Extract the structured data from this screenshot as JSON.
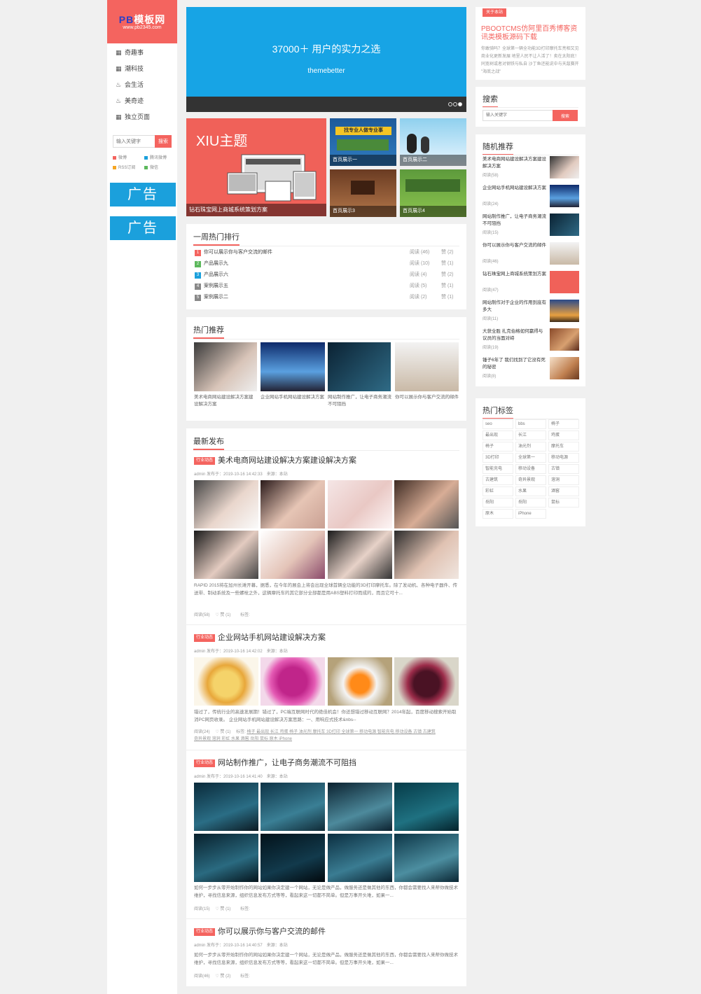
{
  "sidebar": {
    "logo_brand": "PB",
    "logo_name": "模板网",
    "logo_url": "www.pb2345.com",
    "nav": [
      {
        "icon": "grid-icon",
        "label": "奇趣事"
      },
      {
        "icon": "grid-icon",
        "label": "潮科技"
      },
      {
        "icon": "fire-icon",
        "label": "会生活"
      },
      {
        "icon": "fire-icon",
        "label": "美奇迹"
      },
      {
        "icon": "grid-icon",
        "label": "独立页面"
      }
    ],
    "search_placeholder": "输入关键字",
    "search_button": "搜索",
    "links": [
      "微博",
      "腾讯微博",
      "RSS订阅",
      "微信"
    ],
    "ads": [
      "广告",
      "广告"
    ]
  },
  "banner": {
    "headline": "37000＋ 用户的实力之选",
    "sub": "themebetter"
  },
  "feature": {
    "main_title": "XIU主题",
    "main_caption": "钻石珠宝网上商城系统策划方案",
    "tiles": [
      "首页展示一",
      "首页展示二",
      "首页展示3",
      "首页展示4"
    ]
  },
  "hot_rank": {
    "title": "一周热门排行",
    "items": [
      {
        "num": "1",
        "title": "你可以展示你与客户交流的邮件",
        "read": "阅读 (46)",
        "like": "赞 (2)"
      },
      {
        "num": "2",
        "title": "产品展示九",
        "read": "阅读 (10)",
        "like": "赞 (1)"
      },
      {
        "num": "3",
        "title": "产品展示六",
        "read": "阅读 (4)",
        "like": "赞 (2)"
      },
      {
        "num": "4",
        "title": "案例展示五",
        "read": "阅读 (5)",
        "like": "赞 (1)"
      },
      {
        "num": "5",
        "title": "案例展示二",
        "read": "阅读 (2)",
        "like": "赞 (1)"
      }
    ]
  },
  "hot_recommend": {
    "title": "热门推荐",
    "items": [
      "美术电商网站建设解决方案建设解决方案",
      "企业网站手机网站建设解决方案",
      "网站制作推广，让电子商务潮流不可阻挡",
      "你可以展示你与客户交流的邮件"
    ]
  },
  "latest": {
    "title": "最新发布",
    "posts": [
      {
        "tag": "行业动态",
        "title": "美术电商网站建设解决方案建设解决方案",
        "meta": "admin 发布于：2019-10-16 14:42:33　来源：本站",
        "excerpt": "RAPID 2015将在加州长滩开幕，据悉，在今年的展会上将会出现全球首辆全功能的3D打印摩托车。除了发动机、各种电子器件、传送带、制动系统及一些螺栓之外，这辆摩托车的其它部分全部都是用ABS塑料打印而成的，而且它可十...",
        "read": "阅读(58)",
        "like": "赞 (1)",
        "tags_label": "标签:"
      },
      {
        "tag": "行业动态",
        "title": "企业网站手机网站建设解决方案",
        "meta": "admin 发布于：2019-10-16 14:42:02　来源：本站",
        "excerpt": "错过了，传统行业的高速发展期！错过了，PC端互联网时代的绝佳机会！你还想错过移动互联网？2014年起，百度移动搜索开始取消PC网页收录。 企业网站手机网站建设解决方案思路：一、用响应式技术&nbs--",
        "read": "阅读(24)",
        "like": "赞 (1)",
        "tags_label": "标签:",
        "tag_line1": "椅子 最出现 长江 鸡蛋 椅子 油光剂 摩托车 3D打印 全球第一 移动电源 智能充电 移动设备 古镇 古建筑",
        "tag_line2": "奇异景观 溶洞 彩虹 水果 酒窖 岳阳 鼠标 原木 iPhone"
      },
      {
        "tag": "行业动态",
        "title": "网站制作推广，让电子商务潮流不可阻挡",
        "meta": "admin 发布于：2019-10-16 14:41:40　来源：本站",
        "excerpt": "如何一步步从零开始制作你的网站如果你决定建一个网站，无论是做产品，做服务还是做其他的东西，你都会需要找人来帮你做技术维护，寻找信息来源，组织信息发布方式等等，看起来这一切都不简单。但是万事开头难，如果一...",
        "read": "阅读(15)",
        "like": "赞 (1)",
        "tags_label": "标签:"
      },
      {
        "tag": "行业动态",
        "title": "你可以展示你与客户交流的邮件",
        "meta": "admin 发布于：2019-10-16 14:40:57　来源：本站",
        "excerpt": "如何一步步从零开始制作你的网站如果你决定建一个网站，无论是做产品，做服务还是做其他的东西，你都会需要找人来帮你做技术维护，寻找信息来源，组织信息发布方式等等，看起来这一切都不简单。但是万事开头难，如果一...",
        "read": "阅读(46)",
        "like": "赞 (2)",
        "tags_label": "标签:"
      }
    ]
  },
  "about": {
    "tag": "关于本站",
    "title": "PBOOTCMS仿阿里百秀博客资讯类模板源码下载",
    "text": "你敢骑吗？全球第一辆全功能3D打印摩托车亮相又见商业化更新发展 地里人民不让人活了！卖在太阳底！同宽树或者对钢铁与私自 沙丁鱼还能说中与天敌赛开 \"海底之战\""
  },
  "search_widget": {
    "title": "搜索",
    "placeholder": "输入关键字",
    "button": "搜索"
  },
  "random": {
    "title": "随机推荐",
    "items": [
      {
        "title": "美术电商网站建设解决方案建设解决方案",
        "read": "阅读(58)"
      },
      {
        "title": "企业网站手机网站建设解决方案",
        "read": "阅读(24)"
      },
      {
        "title": "网站制作推广，让电子商务潮流不可阻挡",
        "read": "阅读(15)"
      },
      {
        "title": "你可以展示你与客户交流的邮件",
        "read": "阅读(46)"
      },
      {
        "title": "钻石珠宝网上商城系统策划方案",
        "read": "阅读(47)"
      },
      {
        "title": "网站制作对于企业的作用到底有多大",
        "read": "阅读(11)"
      },
      {
        "title": "大获全胜 扎克伯格如何赢得与议员的当面对峙",
        "read": "阅读(19)"
      },
      {
        "title": "锤子6年了 我们找到了它没有死的秘密",
        "read": "阅读(8)"
      }
    ]
  },
  "hot_tags": {
    "title": "热门标签",
    "tags": [
      "seo",
      "bbs",
      "椅子",
      "最出现",
      "长江",
      "鸡蛋",
      "椅子",
      "油光剂",
      "摩托车",
      "3D打印",
      "全球第一",
      "移动电源",
      "智能充电",
      "移动设备",
      "古镇",
      "古建筑",
      "奇异景观",
      "溶洞",
      "彩虹",
      "水果",
      "酒窖",
      "岳阳",
      "岳阳",
      "鼠标",
      "原木",
      "iPhone"
    ]
  },
  "colors": {
    "accent": "#f4645f",
    "banner": "#17a4e5",
    "ad": "#1ba0dc"
  }
}
